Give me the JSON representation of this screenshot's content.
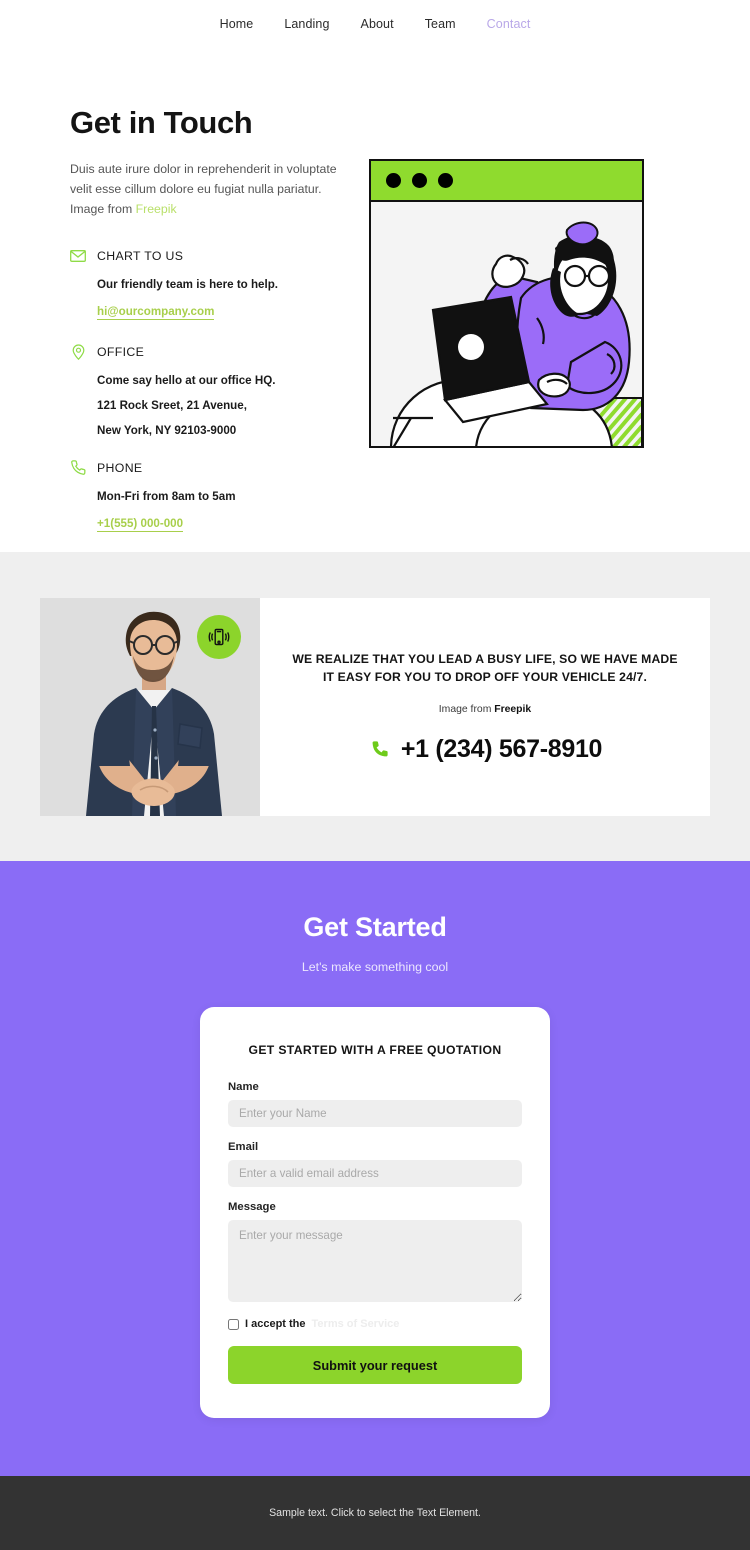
{
  "nav": {
    "items": [
      {
        "label": "Home",
        "active": false
      },
      {
        "label": "Landing",
        "active": false
      },
      {
        "label": "About",
        "active": false
      },
      {
        "label": "Team",
        "active": false
      },
      {
        "label": "Contact",
        "active": true
      }
    ]
  },
  "hero": {
    "title": "Get in Touch",
    "lead_text": "Duis aute irure dolor in reprehenderit in voluptate velit esse cillum dolore eu fugiat nulla pariatur. Image from ",
    "lead_credit": "Freepik",
    "contacts": [
      {
        "icon": "envelope-icon",
        "title": "CHART TO US",
        "line1": "Our friendly team is here to help.",
        "link": "hi@ourcompany.com"
      },
      {
        "icon": "map-pin-icon",
        "title": "OFFICE",
        "line1": "Come say hello at our office HQ.",
        "line2": "121 Rock Sreet, 21 Avenue,",
        "line3": "New York, NY 92103-9000"
      },
      {
        "icon": "phone-icon",
        "title": "PHONE",
        "line1": "Mon-Fri from 8am to 5am",
        "link": "+1(555) 000-000"
      }
    ],
    "illustration": {
      "alt": "woman-with-laptop-illustration",
      "window_dots": 3,
      "bar_color": "#8FDB2E",
      "accent_color": "#9B6CF8"
    }
  },
  "band": {
    "photo_alt": "man-in-navy-shirt-photo",
    "badge_icon": "vibrating-phone-icon",
    "headline": "WE REALIZE THAT YOU LEAD A BUSY LIFE, SO WE HAVE MADE IT EASY FOR YOU TO DROP OFF YOUR VEHICLE 24/7.",
    "credit_prefix": "Image from ",
    "credit_name": "Freepik",
    "phone": "+1 (234) 567-8910"
  },
  "cta": {
    "title": "Get Started",
    "subtitle": "Let's make something cool",
    "form": {
      "title": "GET STARTED WITH A FREE QUOTATION",
      "name_label": "Name",
      "name_placeholder": "Enter your Name",
      "name_value": "",
      "email_label": "Email",
      "email_placeholder": "Enter a valid email address",
      "email_value": "",
      "message_label": "Message",
      "message_placeholder": "Enter your message",
      "message_value": "",
      "accept_text": "I accept the",
      "accept_link": "Terms of Service",
      "accept_checked": false,
      "submit_label": "Submit your request"
    }
  },
  "footer": {
    "text": "Sample text. Click to select the Text Element."
  },
  "colors": {
    "green": "#8CD42B",
    "green_link": "#a8cf4b",
    "purple": "#8A6CF6",
    "illustration_purple": "#9B6CF8",
    "band_bg": "#efefef",
    "footer_bg": "#333333",
    "nav_active": "#b9a8e8"
  }
}
